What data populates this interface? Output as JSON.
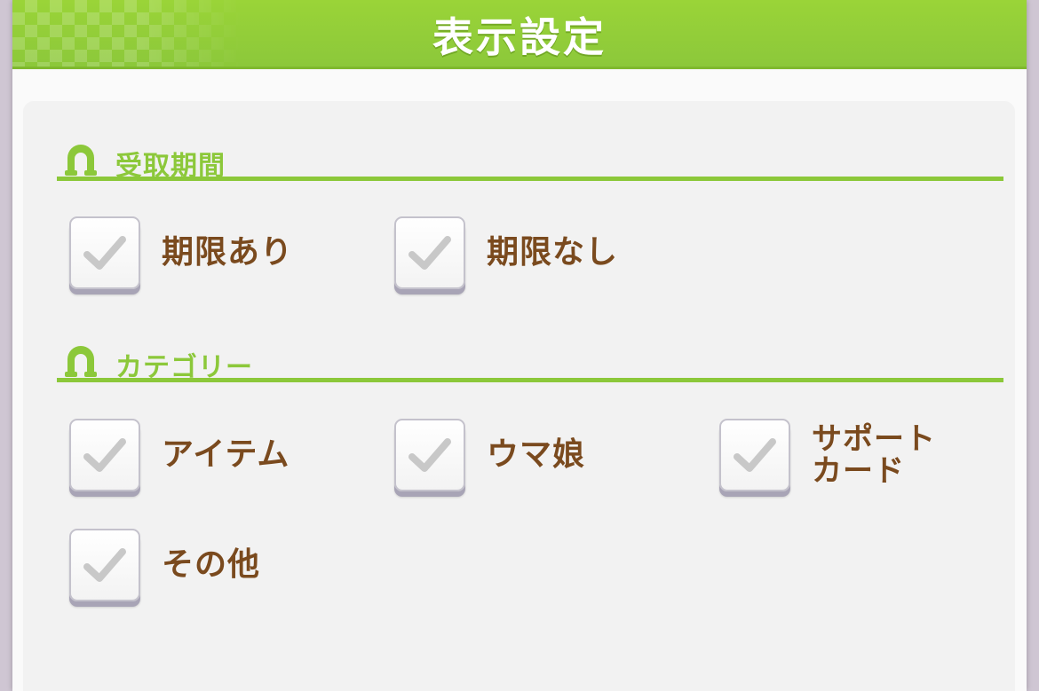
{
  "dialog": {
    "title": "表示設定"
  },
  "sections": {
    "period": {
      "title": "受取期間",
      "icon": "horseshoe-icon",
      "options": {
        "with_limit": {
          "label": "期限あり",
          "checked": true
        },
        "no_limit": {
          "label": "期限なし",
          "checked": true
        }
      }
    },
    "category": {
      "title": "カテゴリー",
      "icon": "horseshoe-icon",
      "options": {
        "item": {
          "label": "アイテム",
          "checked": true
        },
        "uma_musume": {
          "label": "ウマ娘",
          "checked": true
        },
        "support_card": {
          "label": "サポート\nカード",
          "checked": true
        },
        "other": {
          "label": "その他",
          "checked": true
        }
      }
    }
  },
  "colors": {
    "accent_green": "#8cc83a",
    "label_brown": "#7a4a1e",
    "check_gray": "#c8c8c8"
  }
}
